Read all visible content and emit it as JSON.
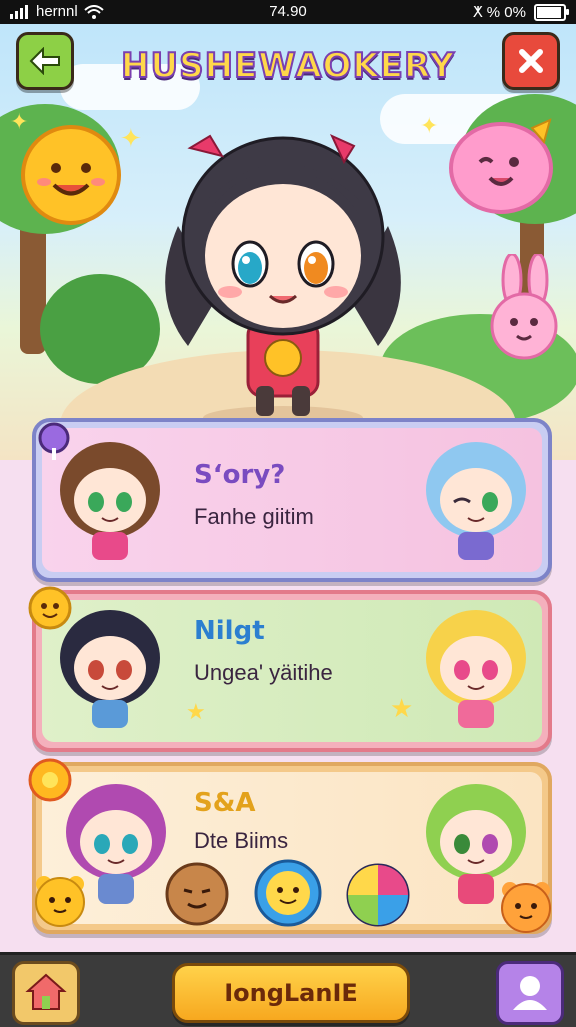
{
  "status_bar": {
    "carrier": "hernnl",
    "time": "74.90",
    "right_text": "ⵅ % 0%",
    "battery_level": 0.85
  },
  "header": {
    "title": "HUSHEWAOKERY"
  },
  "cards": [
    {
      "title": "Sʻory?",
      "subtitle": "Fanhe giitim",
      "title_color": "#7a4bc0"
    },
    {
      "title": "Nilgt",
      "subtitle": "Ungea' yäitihe",
      "title_color": "#2c7fd0"
    },
    {
      "title": "S&A",
      "subtitle": "Dte Biims",
      "title_color": "#e3a21c"
    }
  ],
  "bottom_bar": {
    "play_label": "IongLanIE"
  },
  "colors": {
    "card1": "#f7c7df",
    "card2": "#d8efc4",
    "card3": "#fbe8c8"
  }
}
